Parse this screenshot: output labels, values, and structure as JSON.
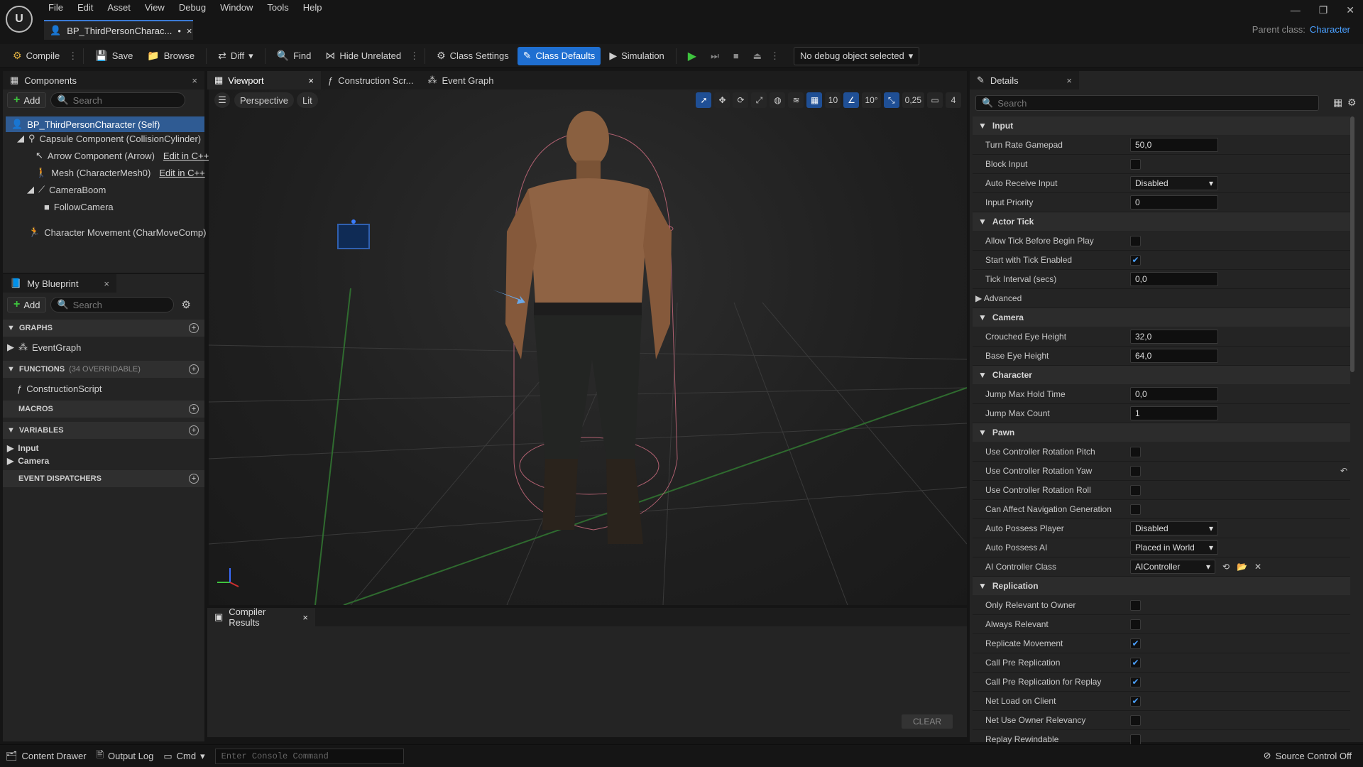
{
  "menu": [
    "File",
    "Edit",
    "Asset",
    "View",
    "Debug",
    "Window",
    "Tools",
    "Help"
  ],
  "logo_text": "U",
  "doc_tab": {
    "title": "BP_ThirdPersonCharac...",
    "modified": "•",
    "close": "×"
  },
  "window_controls": [
    "—",
    "❐",
    "✕"
  ],
  "parent_class": {
    "label": "Parent class:",
    "value": "Character"
  },
  "toolbar": {
    "compile": "Compile",
    "save": "Save",
    "browse": "Browse",
    "diff": "Diff",
    "find": "Find",
    "hide_unrelated": "Hide Unrelated",
    "class_settings": "Class Settings",
    "class_defaults": "Class Defaults",
    "simulation": "Simulation",
    "debug_object": "No debug object selected"
  },
  "components": {
    "tab": "Components",
    "add": "Add",
    "search_placeholder": "Search",
    "items": [
      {
        "label": "BP_ThirdPersonCharacter (Self)"
      },
      {
        "label": "Capsule Component (CollisionCylinder)"
      },
      {
        "label": "Arrow Component (Arrow)",
        "link": "Edit in C++"
      },
      {
        "label": "Mesh (CharacterMesh0)",
        "link": "Edit in C++"
      },
      {
        "label": "CameraBoom"
      },
      {
        "label": "FollowCamera"
      },
      {
        "label": "Character Movement (CharMoveComp)"
      }
    ]
  },
  "my_blueprint": {
    "tab": "My Blueprint",
    "add": "Add",
    "search_placeholder": "Search",
    "graphs": "GRAPHS",
    "event_graph": "EventGraph",
    "functions": "FUNCTIONS",
    "functions_count": "(34 OVERRIDABLE)",
    "construction_script": "ConstructionScript",
    "macros": "MACROS",
    "variables": "VARIABLES",
    "var_input": "Input",
    "var_camera": "Camera",
    "event_dispatchers": "EVENT DISPATCHERS"
  },
  "viewport_tabs": {
    "viewport": "Viewport",
    "construction": "Construction Scr...",
    "event_graph": "Event Graph"
  },
  "viewport": {
    "perspective": "Perspective",
    "lit": "Lit",
    "grid": "10",
    "angle": "10°",
    "scale": "0,25",
    "camera_speed": "4"
  },
  "compiler": {
    "tab": "Compiler Results",
    "clear": "CLEAR"
  },
  "details": {
    "tab": "Details",
    "search_placeholder": "Search",
    "categories": [
      {
        "name": "Input",
        "rows": [
          {
            "label": "Turn Rate Gamepad",
            "type": "num",
            "value": "50,0"
          },
          {
            "label": "Block Input",
            "type": "check",
            "checked": false
          },
          {
            "label": "Auto Receive Input",
            "type": "dropdown",
            "value": "Disabled"
          },
          {
            "label": "Input Priority",
            "type": "num",
            "value": "0"
          }
        ]
      },
      {
        "name": "Actor Tick",
        "rows": [
          {
            "label": "Allow Tick Before Begin Play",
            "type": "check",
            "checked": false
          },
          {
            "label": "Start with Tick Enabled",
            "type": "check",
            "checked": true
          },
          {
            "label": "Tick Interval (secs)",
            "type": "num",
            "value": "0,0"
          },
          {
            "label": "Advanced",
            "type": "sub"
          }
        ]
      },
      {
        "name": "Camera",
        "rows": [
          {
            "label": "Crouched Eye Height",
            "type": "num",
            "value": "32,0"
          },
          {
            "label": "Base Eye Height",
            "type": "num",
            "value": "64,0"
          }
        ]
      },
      {
        "name": "Character",
        "rows": [
          {
            "label": "Jump Max Hold Time",
            "type": "num",
            "value": "0,0"
          },
          {
            "label": "Jump Max Count",
            "type": "num",
            "value": "1"
          }
        ]
      },
      {
        "name": "Pawn",
        "rows": [
          {
            "label": "Use Controller Rotation Pitch",
            "type": "check",
            "checked": false
          },
          {
            "label": "Use Controller Rotation Yaw",
            "type": "check",
            "checked": false,
            "reset": true
          },
          {
            "label": "Use Controller Rotation Roll",
            "type": "check",
            "checked": false
          },
          {
            "label": "Can Affect Navigation Generation",
            "type": "check",
            "checked": false
          },
          {
            "label": "Auto Possess Player",
            "type": "dropdown",
            "value": "Disabled"
          },
          {
            "label": "Auto Possess AI",
            "type": "dropdown",
            "value": "Placed in World"
          },
          {
            "label": "AI Controller Class",
            "type": "class",
            "value": "AIController"
          }
        ]
      },
      {
        "name": "Replication",
        "rows": [
          {
            "label": "Only Relevant to Owner",
            "type": "check",
            "checked": false
          },
          {
            "label": "Always Relevant",
            "type": "check",
            "checked": false
          },
          {
            "label": "Replicate Movement",
            "type": "check",
            "checked": true
          },
          {
            "label": "Call Pre Replication",
            "type": "check",
            "checked": true
          },
          {
            "label": "Call Pre Replication for Replay",
            "type": "check",
            "checked": true
          },
          {
            "label": "Net Load on Client",
            "type": "check",
            "checked": true
          },
          {
            "label": "Net Use Owner Relevancy",
            "type": "check",
            "checked": false
          },
          {
            "label": "Replay Rewindable",
            "type": "check",
            "checked": false
          }
        ]
      }
    ]
  },
  "statusbar": {
    "content_drawer": "Content Drawer",
    "output_log": "Output Log",
    "cmd": "Cmd",
    "console_placeholder": "Enter Console Command",
    "source_control": "Source Control Off"
  },
  "colors": {
    "accent": "#1f6fd1",
    "play": "#3ec43e",
    "link": "#4aa0ff"
  }
}
